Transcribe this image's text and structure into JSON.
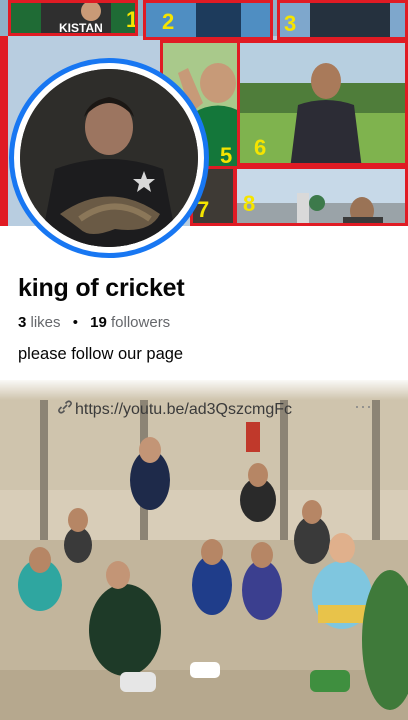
{
  "cover": {
    "tiles": [
      {
        "number": "1",
        "caption": "KISTAN"
      },
      {
        "number": "2",
        "caption": ""
      },
      {
        "number": "3",
        "caption": ""
      },
      {
        "number": "5",
        "caption": ""
      },
      {
        "number": "6",
        "caption": ""
      },
      {
        "number": "7",
        "caption": ""
      },
      {
        "number": "8",
        "caption": ""
      }
    ],
    "frame_color": "#e01b24",
    "number_color": "#f5e400"
  },
  "avatar": {
    "ring_color": "#1877f2"
  },
  "profile": {
    "name": "king of cricket",
    "likes_count": "3",
    "likes_label": "likes",
    "separator": "•",
    "followers_count": "19",
    "followers_label": "followers",
    "bio": "please follow our page"
  },
  "post": {
    "link_text": "https://youtu.be/ad3QszcmgFc",
    "link_icon": "link-icon",
    "more_icon": "more-icon"
  }
}
